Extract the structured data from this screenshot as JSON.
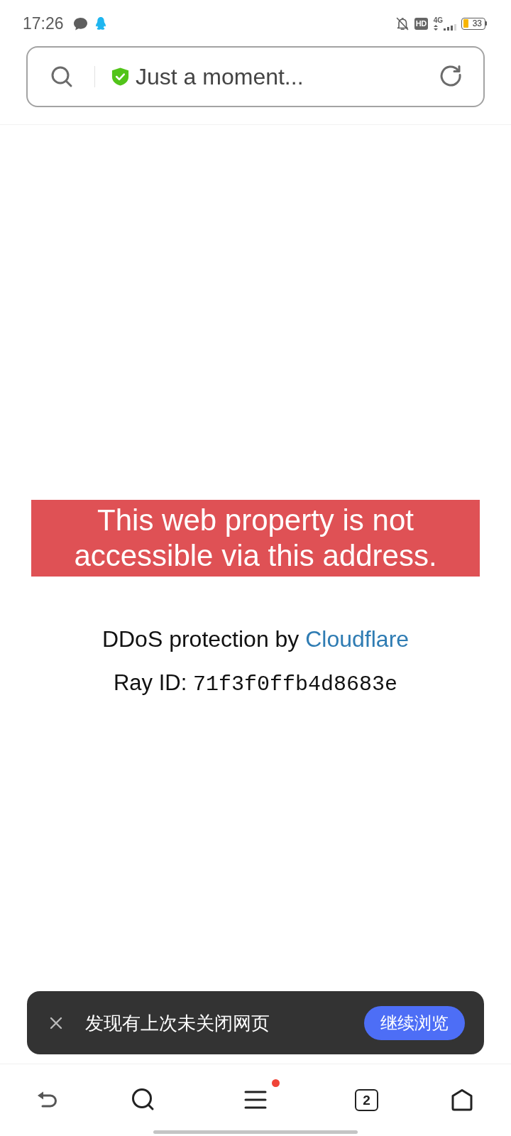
{
  "status_bar": {
    "time": "17:26",
    "hd": "HD",
    "network": "4G",
    "battery": "33"
  },
  "address_bar": {
    "title": "Just a moment..."
  },
  "page": {
    "error_message": "This web property is not accessible via this address.",
    "protection_text": "DDoS protection by",
    "protection_link": "Cloudflare",
    "ray_id_label": "Ray ID:",
    "ray_id": "71f3f0ffb4d8683e"
  },
  "restore_banner": {
    "message": "发现有上次未关闭网页",
    "button": "继续浏览"
  },
  "bottom_nav": [
    {
      "kind": "back"
    },
    {
      "kind": "search"
    },
    {
      "kind": "menu",
      "badge": true
    },
    {
      "kind": "tabs",
      "count": "2"
    },
    {
      "kind": "home"
    }
  ]
}
